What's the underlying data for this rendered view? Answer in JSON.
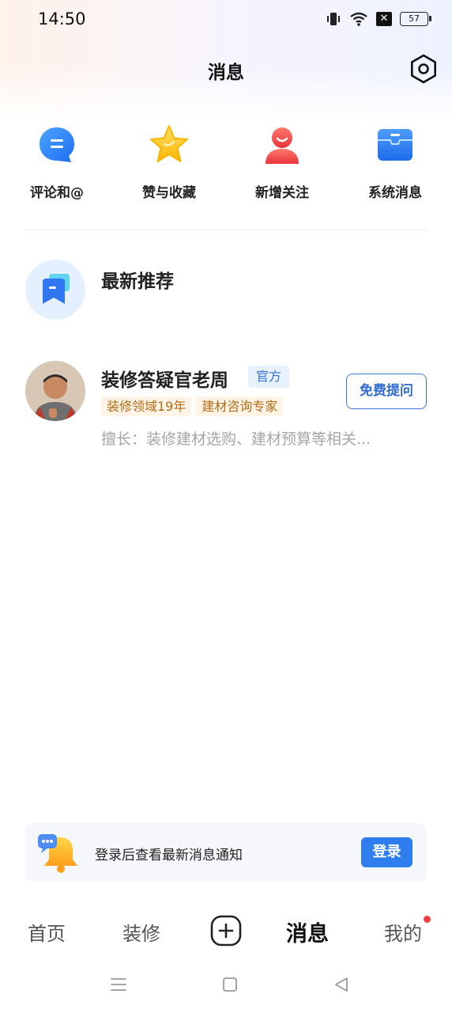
{
  "status_bar": {
    "time": "14:50",
    "battery": "57"
  },
  "header": {
    "title": "消息"
  },
  "quick_actions": [
    {
      "label": "评论和@",
      "icon": "comment-icon"
    },
    {
      "label": "赞与收藏",
      "icon": "star-icon"
    },
    {
      "label": "新增关注",
      "icon": "person-icon"
    },
    {
      "label": "系统消息",
      "icon": "mailbox-icon"
    }
  ],
  "recommend": {
    "title": "最新推荐"
  },
  "expert": {
    "name": "装修答疑官老周",
    "badge": "官方",
    "tags": [
      "装修领域19年",
      "建材咨询专家"
    ],
    "description": "擅长：装修建材选购、建材预算等相关...",
    "ask_button": "免费提问"
  },
  "login_prompt": {
    "text": "登录后查看最新消息通知",
    "button": "登录"
  },
  "tabbar": {
    "home": "首页",
    "decor": "装修",
    "messages": "消息",
    "mine": "我的"
  },
  "colors": {
    "accent": "#2f7ef0",
    "tag_text": "#b46b19",
    "badge_text": "#3471d8",
    "red_dot": "#f04142"
  }
}
